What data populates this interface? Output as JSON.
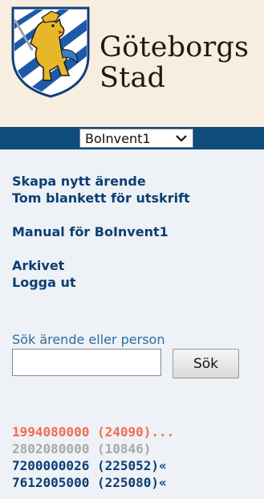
{
  "header": {
    "brand_line1": "Göteborgs",
    "brand_line2": "Stad"
  },
  "nav": {
    "selected_system": "BoInvent1"
  },
  "menu": {
    "create_case": "Skapa nytt ärende",
    "blank_form": "Tom blankett för utskrift",
    "manual": "Manual för BoInvent1",
    "archive": "Arkivet",
    "logout": "Logga ut"
  },
  "search": {
    "label": "Sök ärende eller person",
    "value": "",
    "button": "Sök"
  },
  "cases": [
    {
      "text": "1994080000 (24090)...",
      "color": "#f26c4f"
    },
    {
      "text": "2802080000 (10846)",
      "color": "#a9a9a9"
    },
    {
      "text": "7200000026 (225052)«",
      "color": "#0b3f73"
    },
    {
      "text": "7612005000 (225080)«",
      "color": "#0b3f73"
    }
  ],
  "colors": {
    "nav_bar": "#0e4c7c",
    "link": "#0b3f73",
    "header_bg": "#f7eedf"
  }
}
